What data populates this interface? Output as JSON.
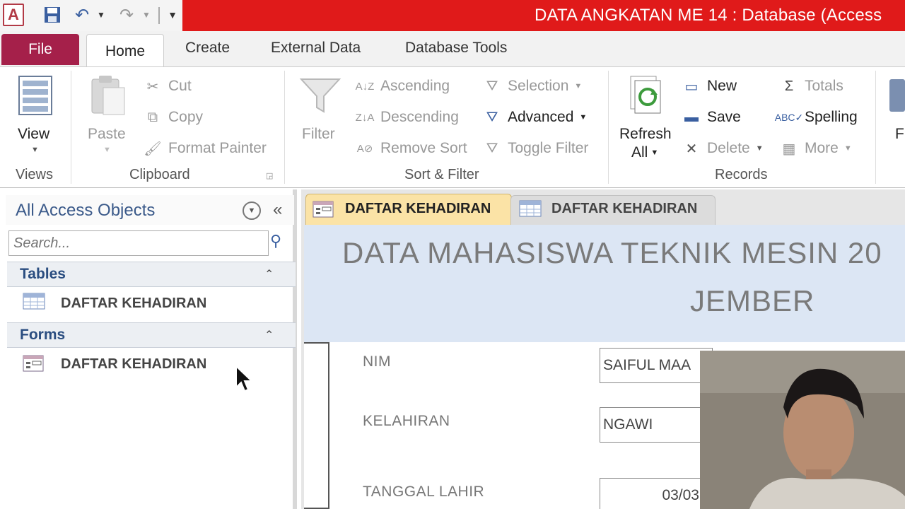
{
  "window": {
    "title": "DATA ANGKATAN ME 14 : Database (Access",
    "app_icon_letter": "A"
  },
  "ribbon_tabs": {
    "file": "File",
    "home": "Home",
    "create": "Create",
    "external_data": "External Data",
    "database_tools": "Database Tools"
  },
  "ribbon": {
    "views": {
      "view": "View",
      "group": "Views"
    },
    "clipboard": {
      "paste": "Paste",
      "cut": "Cut",
      "copy": "Copy",
      "format_painter": "Format Painter",
      "group": "Clipboard"
    },
    "sort_filter": {
      "filter": "Filter",
      "ascending": "Ascending",
      "descending": "Descending",
      "remove_sort": "Remove Sort",
      "selection": "Selection",
      "advanced": "Advanced",
      "toggle_filter": "Toggle Filter",
      "group": "Sort & Filter"
    },
    "records": {
      "refresh": "Refresh",
      "refresh_all": "All",
      "new": "New",
      "save": "Save",
      "delete": "Delete",
      "totals": "Totals",
      "spelling": "Spelling",
      "more": "More",
      "group": "Records"
    },
    "find_partial": "F"
  },
  "nav_pane": {
    "title": "All Access Objects",
    "search_placeholder": "Search...",
    "sections": [
      {
        "label": "Tables",
        "items": [
          "DAFTAR KEHADIRAN"
        ]
      },
      {
        "label": "Forms",
        "items": [
          "DAFTAR KEHADIRAN"
        ]
      }
    ]
  },
  "doc_tabs": [
    {
      "label": "DAFTAR KEHADIRAN",
      "type": "form",
      "active": true
    },
    {
      "label": "DAFTAR KEHADIRAN",
      "type": "table",
      "active": false
    }
  ],
  "form": {
    "title_line1": "DATA MAHASISWA TEKNIK MESIN 20",
    "title_line2": "JEMBER",
    "fields": [
      {
        "label": "NIM",
        "value": "SAIFUL MAA"
      },
      {
        "label": "KELAHIRAN",
        "value": "NGAWI"
      },
      {
        "label": "TANGGAL LAHIR",
        "value": "03/03"
      }
    ]
  },
  "colors": {
    "titlebar_red": "#e01a1a",
    "file_tab": "#a5204a",
    "form_header": "#dce6f4",
    "active_doc_tab": "#fbe3a6"
  }
}
